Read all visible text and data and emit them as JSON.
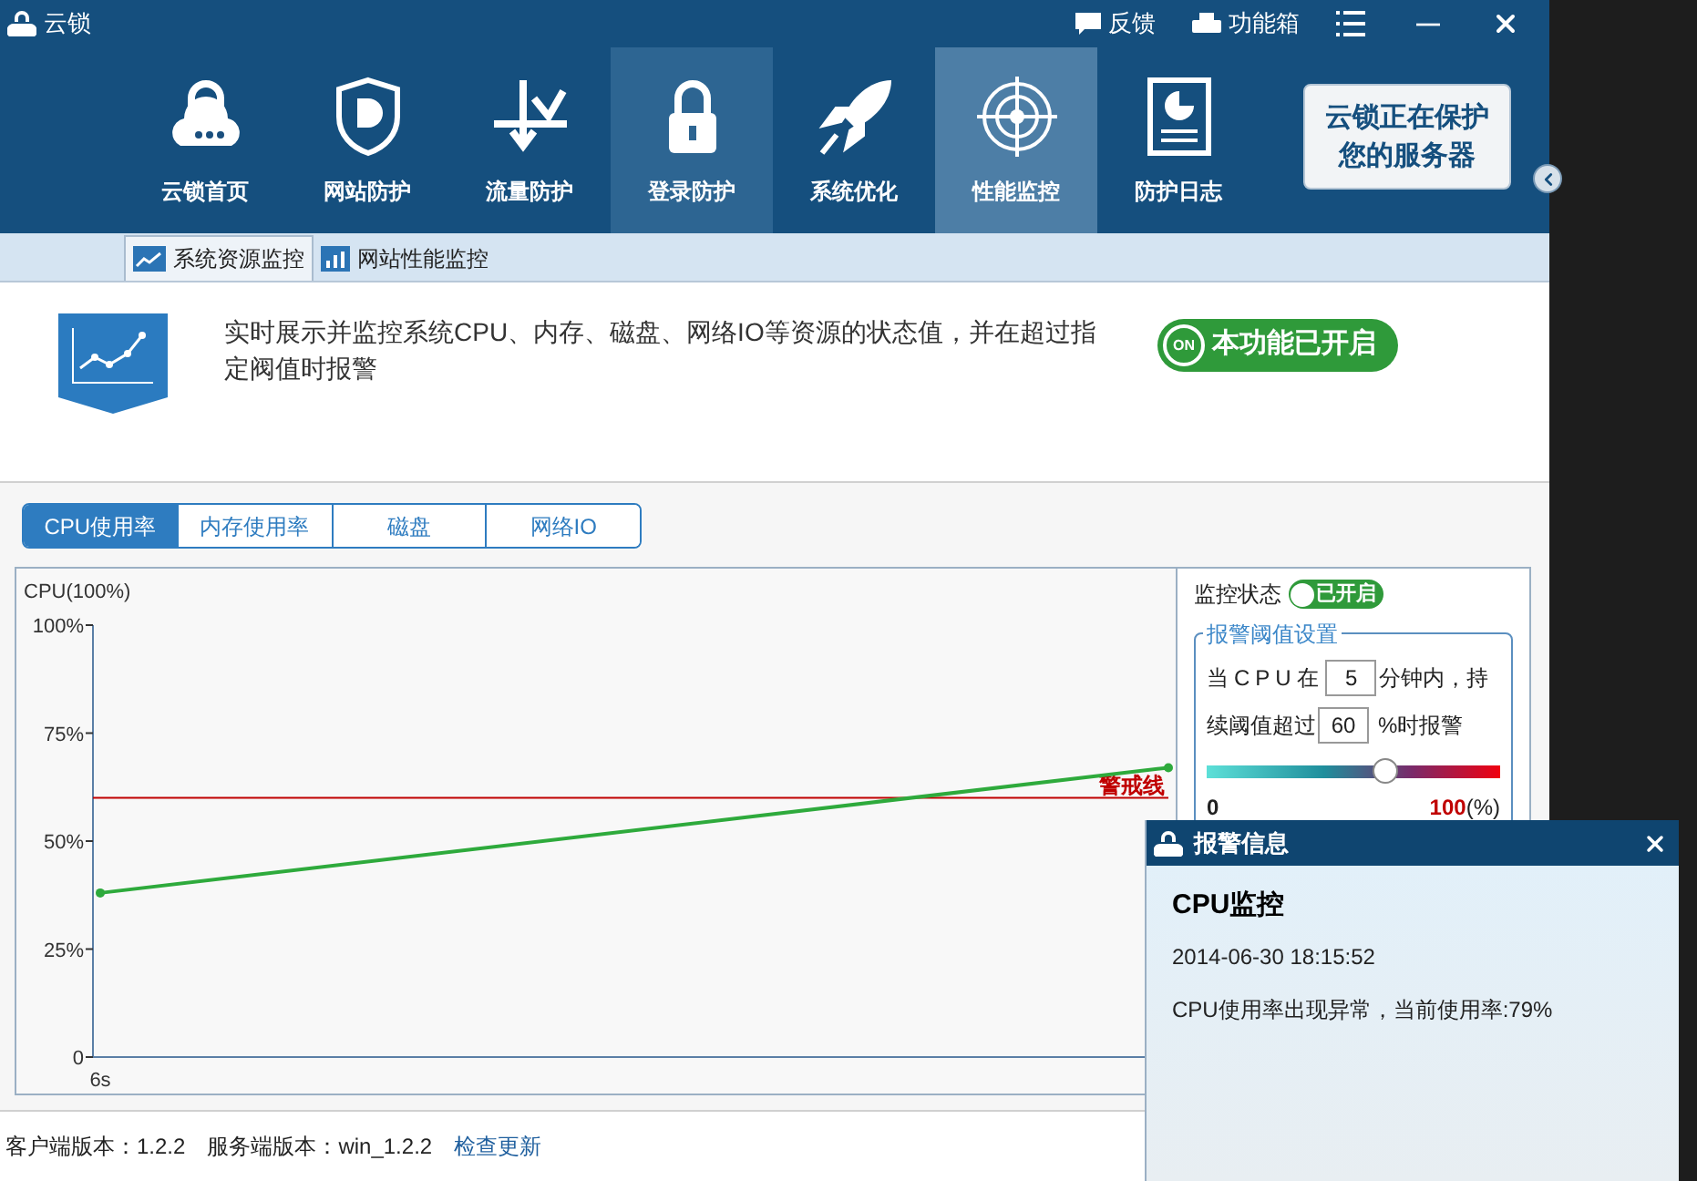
{
  "window": {
    "title": "云锁",
    "feedback": "反馈",
    "toolbox": "功能箱",
    "minimize": "—"
  },
  "nav": [
    {
      "label": "云锁首页",
      "selected": false,
      "hovered": false
    },
    {
      "label": "网站防护",
      "selected": false,
      "hovered": false
    },
    {
      "label": "流量防护",
      "selected": false,
      "hovered": false
    },
    {
      "label": "登录防护",
      "selected": false,
      "hovered": true
    },
    {
      "label": "系统优化",
      "selected": false,
      "hovered": false
    },
    {
      "label": "性能监控",
      "selected": true,
      "hovered": false
    },
    {
      "label": "防护日志",
      "selected": false,
      "hovered": false
    }
  ],
  "status_badge": {
    "line_1": "云锁正在保护",
    "line_2": "您的服务器"
  },
  "sub_tabs": [
    {
      "label": "系统资源监控",
      "selected": true
    },
    {
      "label": "网站性能监控",
      "selected": false
    }
  ],
  "info": {
    "description": "实时展示并监控系统CPU、内存、磁盘、网络IO等资源的状态值，并在超过指定阀值时报警",
    "switch_label": "ON",
    "switch_text": "本功能已开启",
    "on": true
  },
  "metric_tabs": [
    {
      "label": "CPU使用率",
      "selected": true
    },
    {
      "label": "内存使用率",
      "selected": false
    },
    {
      "label": "磁盘",
      "selected": false
    },
    {
      "label": "网络IO",
      "selected": false
    }
  ],
  "chart": {
    "chart_data": {
      "type": "line",
      "ylabel": "CPU(100%)",
      "ylim": [
        0,
        100
      ],
      "yticks": [
        {
          "value": 0,
          "label": "0"
        },
        {
          "value": 25,
          "label": "25%"
        },
        {
          "value": 50,
          "label": "50%"
        },
        {
          "value": 75,
          "label": "75%"
        },
        {
          "value": 100,
          "label": "100%"
        }
      ],
      "series": [
        {
          "color": "#2eaa3c",
          "marker": "circle",
          "values": [
            38,
            67
          ]
        }
      ],
      "ref_lines": [
        {
          "label": "警戒线",
          "color": "#c00000"
        }
      ],
      "annotations": [
        "6s"
      ]
    }
  },
  "monitor": {
    "status_label": "监控状态",
    "status_text": "已开启",
    "on": true,
    "group_title": "报警阈值设置",
    "text_1": "当CPU在",
    "minutes": "5",
    "text_2": "分钟内，持",
    "text_3": "续阈值超过",
    "threshold": "60",
    "text_4": "%时报警",
    "level": 0.61,
    "min": "0",
    "max": "100",
    "unit": "(%)"
  },
  "footer": {
    "client_version": "客户端版本：1.2.2",
    "server_version": "服务端版本：win_1.2.2",
    "link": "检查更新"
  },
  "alert": {
    "title": "报警信息",
    "heading": "CPU监控",
    "time": "2014-06-30 18:15:52",
    "message": "CPU使用率出现异常，当前使用率:79%"
  }
}
